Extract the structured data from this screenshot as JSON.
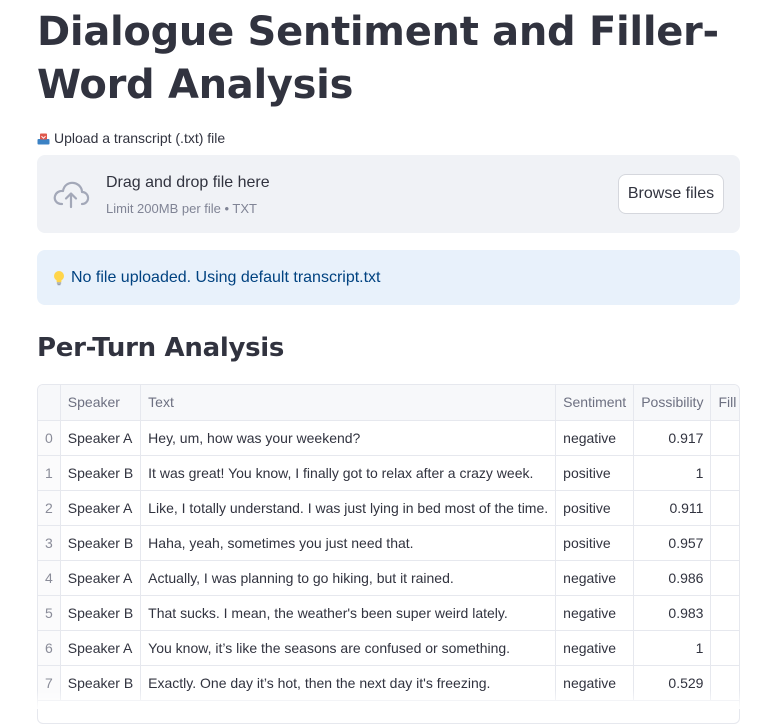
{
  "page": {
    "title": "Dialogue Sentiment and Filler-Word Analysis"
  },
  "uploader": {
    "label": "Upload a transcript (.txt) file",
    "label_icon": "inbox-tray-icon",
    "drop_title": "Drag and drop file here",
    "drop_limit": "Limit 200MB per file • TXT",
    "browse_label": "Browse files",
    "cloud_icon": "cloud-upload-icon"
  },
  "info": {
    "icon": "lightbulb-icon",
    "message": "No file uploaded. Using default transcript.txt"
  },
  "analysis": {
    "heading": "Per-Turn Analysis",
    "columns": [
      "",
      "Speaker",
      "Text",
      "Sentiment",
      "Possibility",
      "Fill"
    ],
    "rows": [
      {
        "index": "0",
        "speaker": "Speaker A",
        "text": "Hey, um, how was your weekend?",
        "sentiment": "negative",
        "possibility": "0.917"
      },
      {
        "index": "1",
        "speaker": "Speaker B",
        "text": "It was great! You know, I finally got to relax after a crazy week.",
        "sentiment": "positive",
        "possibility": "1"
      },
      {
        "index": "2",
        "speaker": "Speaker A",
        "text": "Like, I totally understand. I was just lying in bed most of the time.",
        "sentiment": "positive",
        "possibility": "0.911"
      },
      {
        "index": "3",
        "speaker": "Speaker B",
        "text": "Haha, yeah, sometimes you just need that.",
        "sentiment": "positive",
        "possibility": "0.957"
      },
      {
        "index": "4",
        "speaker": "Speaker A",
        "text": "Actually, I was planning to go hiking, but it rained.",
        "sentiment": "negative",
        "possibility": "0.986"
      },
      {
        "index": "5",
        "speaker": "Speaker B",
        "text": "That sucks. I mean, the weather's been super weird lately.",
        "sentiment": "negative",
        "possibility": "0.983"
      },
      {
        "index": "6",
        "speaker": "Speaker A",
        "text": "You know, it’s like the seasons are confused or something.",
        "sentiment": "negative",
        "possibility": "1"
      },
      {
        "index": "7",
        "speaker": "Speaker B",
        "text": "Exactly. One day it’s hot, then the next day it's freezing.",
        "sentiment": "negative",
        "possibility": "0.529"
      }
    ]
  },
  "colors": {
    "text": "#31333f",
    "dropzone_bg": "#f0f2f6",
    "info_bg": "#e8f1fb",
    "info_text": "#004280",
    "muted": "#808495"
  }
}
